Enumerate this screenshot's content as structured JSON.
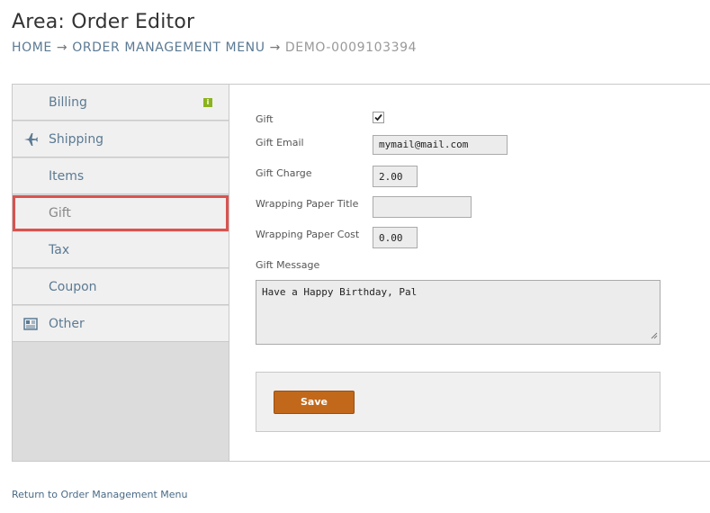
{
  "header": {
    "title": "Area: Order Editor",
    "breadcrumb": {
      "home": "HOME",
      "separator": "→",
      "menu": "ORDER MANAGEMENT MENU",
      "current": "DEMO-0009103394"
    }
  },
  "sidebar": {
    "items": [
      {
        "label": "Billing",
        "icon": "info-badge-icon"
      },
      {
        "label": "Shipping",
        "icon": "airplane-icon"
      },
      {
        "label": "Items"
      },
      {
        "label": "Gift",
        "active": true
      },
      {
        "label": "Tax"
      },
      {
        "label": "Coupon"
      },
      {
        "label": "Other",
        "icon": "newspaper-icon"
      }
    ],
    "billing_badge": "i"
  },
  "form": {
    "gift_label": "Gift",
    "gift_checked": true,
    "gift_email_label": "Gift Email",
    "gift_email_value": "mymail@mail.com",
    "gift_charge_label": "Gift Charge",
    "gift_charge_value": "2.00",
    "wrapping_title_label": "Wrapping Paper Title",
    "wrapping_title_value": "",
    "wrapping_cost_label": "Wrapping Paper Cost",
    "wrapping_cost_value": "0.00",
    "gift_message_label": "Gift Message",
    "gift_message_value": "Have a Happy Birthday, Pal",
    "save_label": "Save"
  },
  "footer": {
    "return_link": "Return to Order Management Menu"
  },
  "colors": {
    "accent_button": "#c2681a",
    "active_outline": "#d9534f",
    "link": "#5b7a93",
    "badge": "#8bb31c"
  }
}
